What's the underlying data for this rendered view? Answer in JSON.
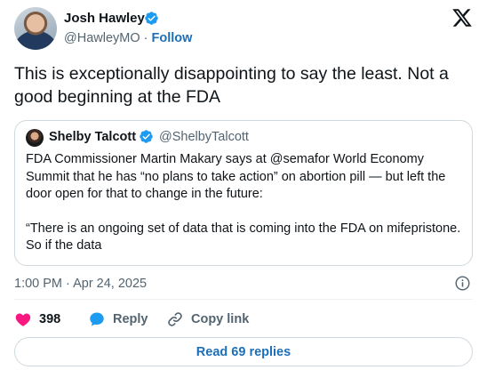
{
  "author": {
    "name": "Josh Hawley",
    "handle": "@HawleyMO",
    "separator": "·",
    "follow_label": "Follow"
  },
  "tweet_text": "This is exceptionally disappointing to say the least. Not a good beginning at the FDA",
  "quote": {
    "name": "Shelby Talcott",
    "handle": "@ShelbyTalcott",
    "paragraph1": "FDA Commissioner Martin Makary says at @semafor World Economy Summit that he has “no plans to take action” on abortion pill — but left the door open for that to change in the future:",
    "paragraph2": "“There is an ongoing set of data that is coming into the FDA on mifepristone. So if the data"
  },
  "timestamp": "1:00 PM · Apr 24, 2025",
  "actions": {
    "like_count": "398",
    "reply_label": "Reply",
    "copy_label": "Copy link"
  },
  "read_replies_label": "Read 69 replies",
  "colors": {
    "verified": "#1d9bf0",
    "like": "#f91880",
    "reply": "#1d9bf0",
    "link": "#1d6fb8",
    "muted": "#536471"
  },
  "icons": [
    "verified-badge-icon",
    "x-logo-icon",
    "info-icon",
    "heart-icon",
    "reply-bubble-icon",
    "link-icon"
  ]
}
